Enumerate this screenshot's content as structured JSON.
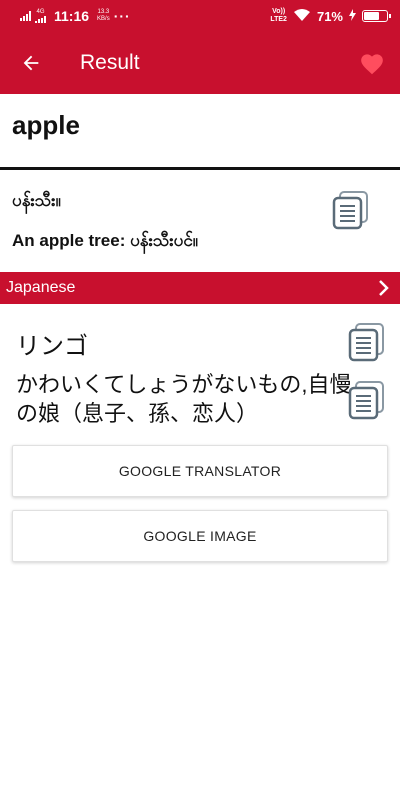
{
  "status_bar": {
    "network_type": "4G",
    "time": "11:16",
    "speed_value": "13.3",
    "speed_unit": "KB/s",
    "more": "···",
    "volte_top": "Vo))",
    "volte_bottom": "LTE2",
    "battery_percent": "71%",
    "battery_level": 0.71
  },
  "app_bar": {
    "title": "Result",
    "back_icon": "arrow-left-icon",
    "favorite_icon": "heart-icon"
  },
  "search": {
    "word": "apple"
  },
  "burmese": {
    "definition": "ပန်းသီး။",
    "example": "An apple tree: ပန်းသီးပင်။"
  },
  "language_section": {
    "label": "Japanese",
    "chevron_icon": "chevron-right-icon"
  },
  "japanese": {
    "translation": "リンゴ",
    "phrase": "かわいくてしょうがないもの,自慢の娘（息子、孫、恋人）"
  },
  "actions": {
    "google_translator": "GOOGLE TRANSLATOR",
    "google_image": "GOOGLE IMAGE"
  },
  "colors": {
    "primary": "#c8102e",
    "favorite": "#ff4d5e",
    "copy_icon": "#5a6b78"
  }
}
